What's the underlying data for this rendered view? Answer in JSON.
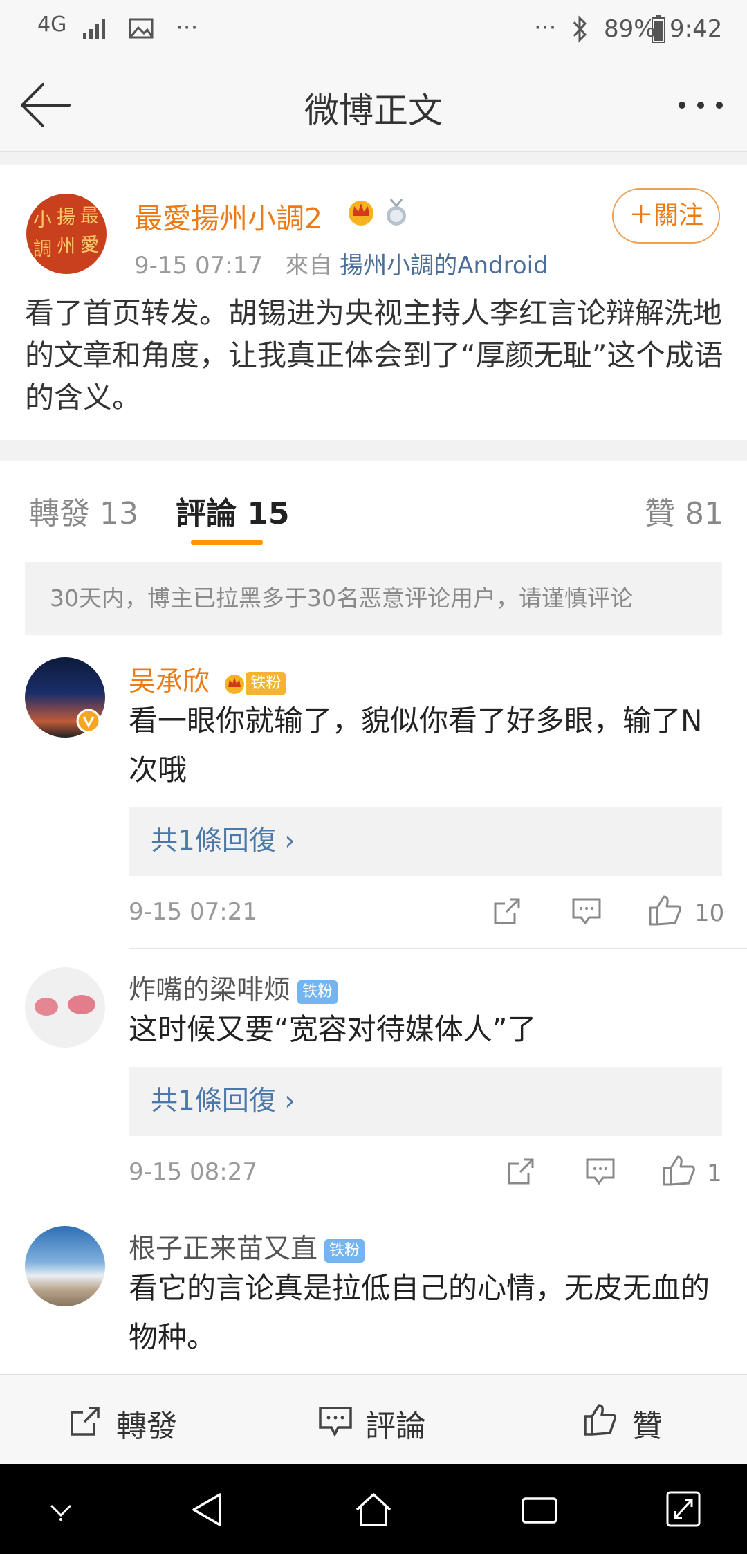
{
  "status_bar": {
    "network": "4G",
    "battery": "89%",
    "time": "9:42"
  },
  "header": {
    "title": "微博正文"
  },
  "post": {
    "author": "最愛揚州小調2",
    "date": "9-15 07:17",
    "from_prefix": "來自",
    "source": "揚州小調的Android",
    "follow_label": "＋關注",
    "avatar_text": [
      "小",
      "揚",
      "最",
      "調",
      "州",
      "愛"
    ],
    "body": "看了首页转发。胡锡进为央视主持人李红言论辩解洗地的文章和角度，让我真正体会到了“厚颜无耻”这个成语的含义。"
  },
  "tabs": {
    "reposts": "轉發 13",
    "comments": "評論 15",
    "likes": "贊 81"
  },
  "notice": "30天内，博主已拉黑多于30名恶意评论用户，请谨慎评论",
  "comments": [
    {
      "name": "吴承欣",
      "badge": "铁粉",
      "text": "看一眼你就输了，貌似你看了好多眼，输了N次哦",
      "replies": "共1條回復 ›",
      "time": "9-15 07:21",
      "likes": "10"
    },
    {
      "name": "炸嘴的梁啡烦",
      "badge": "铁粉",
      "text": "这时候又要“宽容对待媒体人”了",
      "replies": "共1條回復 ›",
      "time": "9-15 08:27",
      "likes": "1"
    },
    {
      "name": "根子正来苗又直",
      "badge": "铁粉",
      "text": "看它的言论真是拉低自己的心情，无皮无血的物种。"
    }
  ],
  "action_bar": {
    "repost": "轉發",
    "comment": "評論",
    "like": "贊"
  },
  "colors": {
    "accent": "#ff9500",
    "author": "#ee7a14",
    "link": "#4b77a9"
  }
}
